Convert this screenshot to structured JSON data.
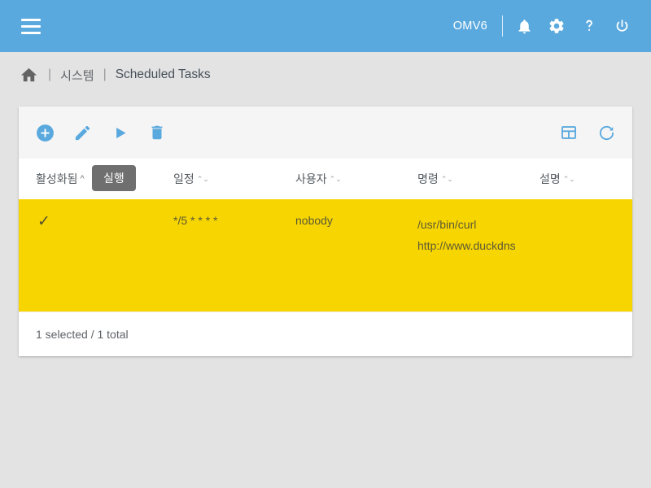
{
  "appbar": {
    "menu_icon": "hamburger-icon",
    "brand": "OMV6",
    "icons": [
      {
        "name": "notifications-bell-icon",
        "label": "Notifications"
      },
      {
        "name": "settings-gear-icon",
        "label": "Settings"
      },
      {
        "name": "help-question-icon",
        "label": "Help"
      },
      {
        "name": "power-icon",
        "label": "Power"
      }
    ],
    "background_color": "#5aa9de"
  },
  "breadcrumb": {
    "home_icon": "home-icon",
    "separator": "|",
    "items": [
      {
        "label": "시스템"
      },
      {
        "label": "Scheduled Tasks"
      }
    ]
  },
  "toolbar": {
    "left_buttons": [
      {
        "name": "add-button",
        "icon": "plus-circle-icon",
        "label": "추가"
      },
      {
        "name": "edit-button",
        "icon": "pencil-icon",
        "label": "편집"
      },
      {
        "name": "run-button",
        "icon": "play-icon",
        "label": "실행"
      },
      {
        "name": "delete-button",
        "icon": "trash-icon",
        "label": "삭제"
      }
    ],
    "right_buttons": [
      {
        "name": "columns-button",
        "icon": "grid-columns-icon",
        "label": "컬럼"
      },
      {
        "name": "reload-button",
        "icon": "refresh-icon",
        "label": "새로 고침"
      }
    ],
    "accent_color": "#5aa9de"
  },
  "tooltip": {
    "visible": true,
    "text": "실행",
    "background_color": "#6f6f6f"
  },
  "table": {
    "columns": [
      {
        "key": "enabled",
        "label": "활성화됨",
        "sorted": "asc",
        "sort_glyph": "^"
      },
      {
        "key": "exec",
        "label": "실행",
        "sorted": "none",
        "sort_glyph": ""
      },
      {
        "key": "sched",
        "label": "일정",
        "sorted": "none",
        "sort_glyph": "⌃⌄"
      },
      {
        "key": "user",
        "label": "사용자",
        "sorted": "none",
        "sort_glyph": "⌃⌄"
      },
      {
        "key": "cmd",
        "label": "명령",
        "sorted": "none",
        "sort_glyph": "⌃⌄"
      },
      {
        "key": "desc",
        "label": "설명",
        "sorted": "none",
        "sort_glyph": "⌃⌄"
      }
    ],
    "rows": [
      {
        "selected": true,
        "enabled_glyph": "✓",
        "exec": "",
        "sched": "*/5 * * * *",
        "user": "nobody",
        "cmd_line1": "/usr/bin/curl",
        "cmd_line2": "http://www.duckdns",
        "desc": ""
      }
    ],
    "selected_row_color": "#f7d500",
    "footer_status": "1 selected / 1 total"
  }
}
